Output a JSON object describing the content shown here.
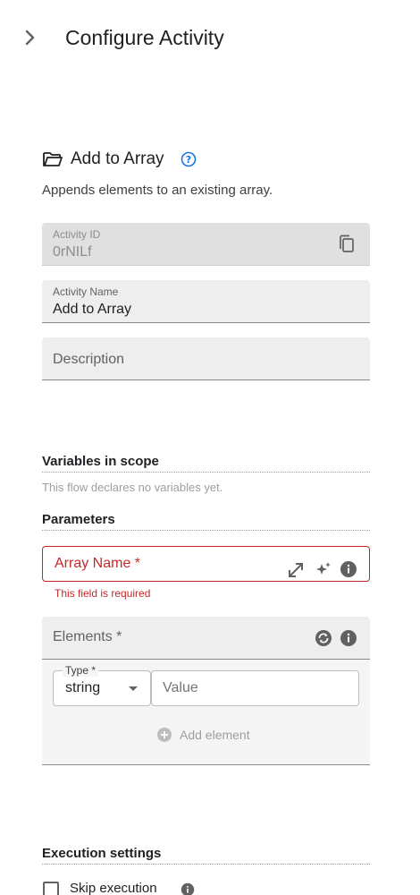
{
  "header": {
    "title": "Configure Activity",
    "expand_icon": "chevron-right-icon"
  },
  "activity": {
    "title": "Add to Array",
    "description": "Appends elements to an existing array.",
    "icon": "folder-open-icon",
    "help_icon": "help-circle-icon"
  },
  "fields": {
    "activity_id": {
      "label": "Activity ID",
      "value": "0rNILf"
    },
    "activity_name": {
      "label": "Activity Name",
      "value": "Add to Array"
    },
    "description": {
      "placeholder": "Description"
    }
  },
  "variables": {
    "title": "Variables in scope",
    "note": "This flow declares no variables yet."
  },
  "parameters": {
    "title": "Parameters",
    "array_name": {
      "placeholder": "Array Name *",
      "error": "This field is required"
    },
    "elements": {
      "label": "Elements *",
      "type_label": "Type *",
      "type_value": "string",
      "value_placeholder": "Value",
      "add_label": "Add element"
    }
  },
  "execution": {
    "title": "Execution settings",
    "skip_label": "Skip execution"
  },
  "colors": {
    "error": "#c62828",
    "accent": "#1a73e8",
    "icon_grey": "#616161"
  }
}
